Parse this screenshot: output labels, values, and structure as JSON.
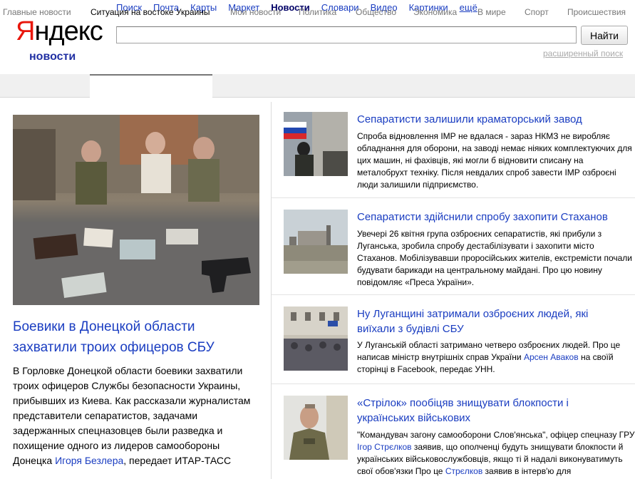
{
  "logo": {
    "first": "Я",
    "rest": "ндекс",
    "sub": "новости"
  },
  "services": [
    {
      "label": "Поиск",
      "active": false
    },
    {
      "label": "Почта",
      "active": false
    },
    {
      "label": "Карты",
      "active": false
    },
    {
      "label": "Маркет",
      "active": false
    },
    {
      "label": "Новости",
      "active": true
    },
    {
      "label": "Словари",
      "active": false
    },
    {
      "label": "Видео",
      "active": false
    },
    {
      "label": "Картинки",
      "active": false
    },
    {
      "label": "ещё",
      "active": false
    }
  ],
  "search": {
    "value": "",
    "button": "Найти",
    "advanced": "расширенный поиск"
  },
  "tabs": [
    {
      "label": "Главные новости"
    },
    {
      "label": "Ситуация на востоке Украины"
    },
    {
      "label": "Мои новости"
    },
    {
      "label": "Политика"
    },
    {
      "label": "Общество"
    },
    {
      "label": "Экономика"
    },
    {
      "label": "В мире"
    },
    {
      "label": "Спорт"
    },
    {
      "label": "Происшествия"
    }
  ],
  "main_story": {
    "title": "Боевики в Донецкой области захватили троих офицеров СБУ",
    "text_before": "В Горловке Донецкой области боевики захватили троих офицеров Службы безопасности Украины, прибывших из Киева. Как рассказали журналистам представители сепаратистов, задачами задержанных спецназовцев были разведка и похищение одного из лидеров самообороны Донецка ",
    "person": "Игоря Безлера",
    "text_after": ", передает ИТАР-ТАСС"
  },
  "stories": [
    {
      "title": "Сепаратисти залишили краматорський завод",
      "text": "Спроба відновлення ІМР не вдалася - зараз НКМЗ не виробляє обладнання для оборони, на заводі немає ніяких комплектуючих для цих машин, ні фахівців, які могли б відновити списану на металобрухт техніку. Після невдалих спроб завести ІМР озброєні люди залишили підприємство."
    },
    {
      "title": "Сепаратисти здійснили спробу захопити Стаханов",
      "text": "Увечері 26 квітня група озброєних сепаратистів, які прибули з Луганська, зробила спробу дестабілізувати і захопити місто Стаханов. Мобілізувавши проросійських жителів, екстремісти почали будувати барикади на центральному майдані. Про цю новину повідомляє «Преса України»."
    },
    {
      "title": "Ну Луганщині затримали озброєних людей, які виїхали з будівлі СБУ",
      "text_before": "У Луганській області затримано четверо озброєних людей. Про це написав міністр внутрішніх справ України ",
      "person": "Арсен Аваков",
      "text_after": " на своїй сторінці в Facebook, передає УНН."
    },
    {
      "title": "«Стрілок» пообіцяв знищувати блокпости і українських військових",
      "text_before": "\"Командувач загону самооборони Слов'янська\", офіцер спецназу ГРУ ",
      "person": "Ігор Стрєлков",
      "text_mid": " заявив, що ополченці будуть знищувати блокпости й українських військовослужбовців, якщо ті й надалі виконуватимуть свої обов'язки Про це ",
      "person2": "Стрєлков",
      "text_after": " заявив в інтерв'ю для"
    }
  ],
  "colors": {
    "link": "#1a3dc1",
    "logo_red": "#e8160c",
    "tab_bg": "#f0f0f0"
  }
}
